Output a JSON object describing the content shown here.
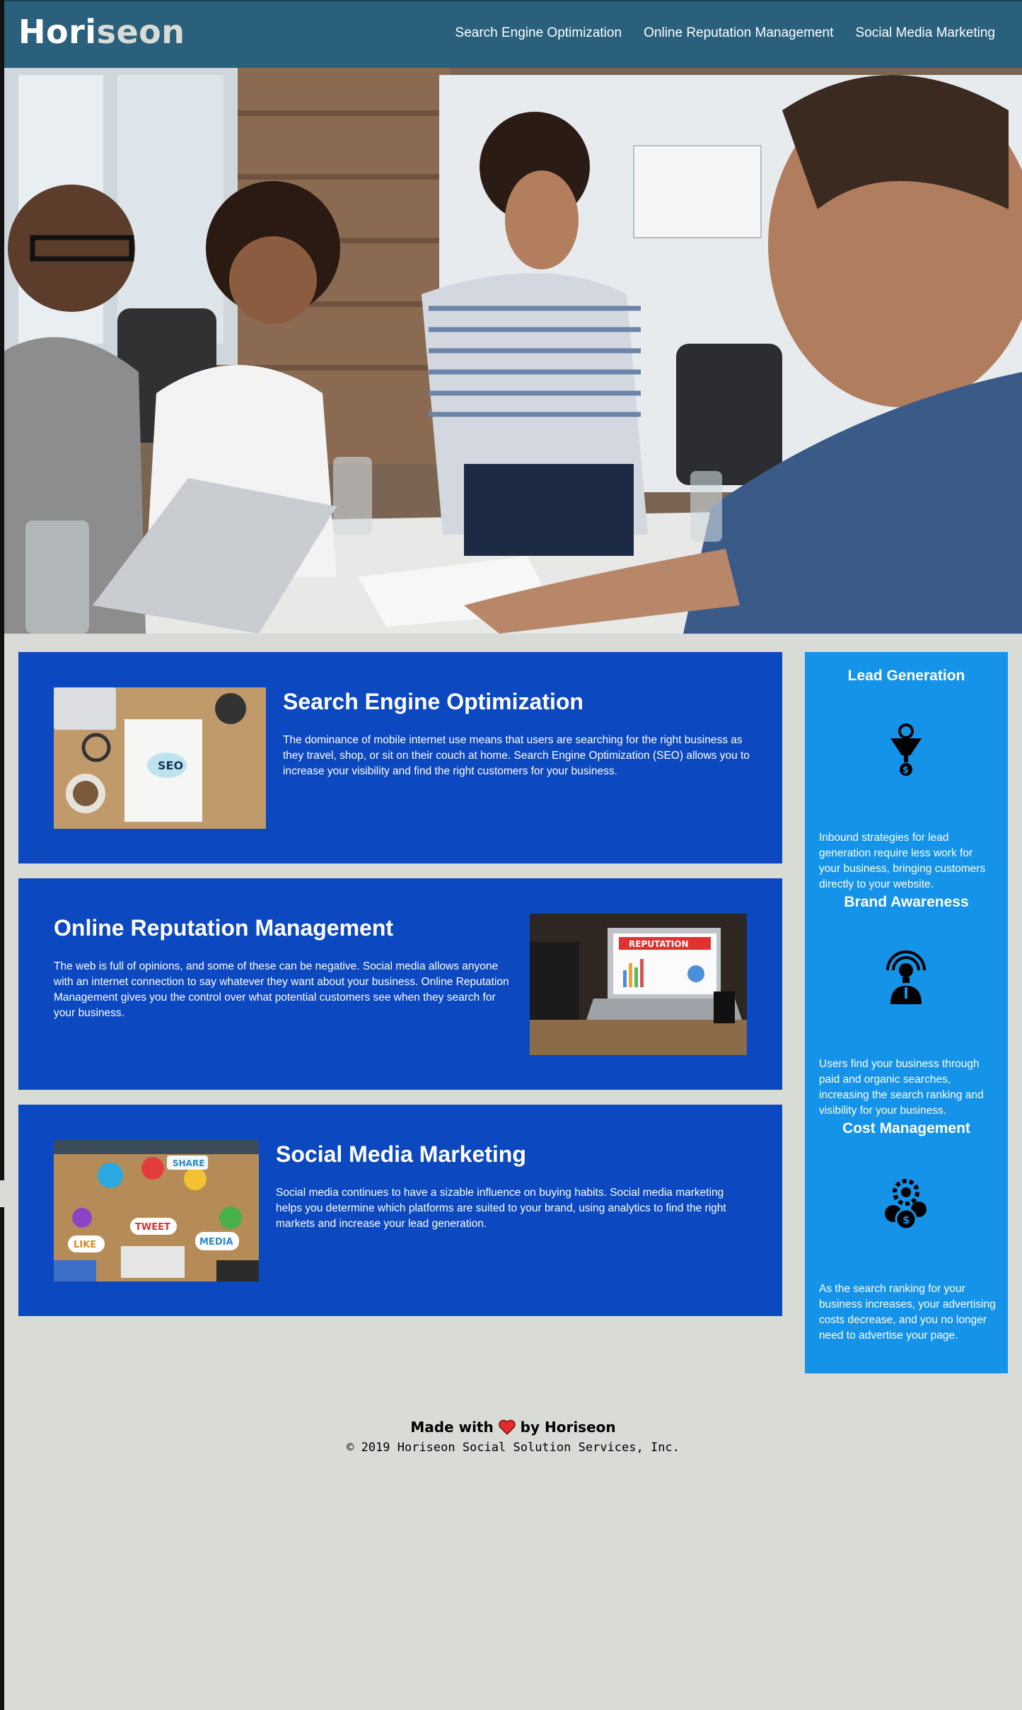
{
  "header": {
    "logo_part1": "Hori",
    "logo_part2": "seon",
    "nav": [
      {
        "label": "Search Engine Optimization"
      },
      {
        "label": "Online Reputation Management"
      },
      {
        "label": "Social Media Marketing"
      }
    ]
  },
  "hero": {
    "description": "team meeting around a table with laptop"
  },
  "cards": [
    {
      "title": "Search Engine Optimization",
      "text": "The dominance of mobile internet use means that users are searching for the right business as they travel, shop, or sit on their couch at home. Search Engine Optimization (SEO) allows you to increase your visibility and find the right customers for your business.",
      "image_label": "SEO"
    },
    {
      "title": "Online Reputation Management",
      "text": "The web is full of opinions, and some of these can be negative. Social media allows anyone with an internet connection to say whatever they want about your business. Online Reputation Management gives you the control over what potential customers see when they search for your business.",
      "image_label": "REPUTATION"
    },
    {
      "title": "Social Media Marketing",
      "text": "Social media continues to have a sizable influence on buying habits. Social media marketing helps you determine which platforms are suited to your brand, using analytics to find the right markets and increase your lead generation.",
      "image_labels": [
        "SHARE",
        "TWEET",
        "LIKE",
        "MEDIA"
      ]
    }
  ],
  "sidebar": [
    {
      "title": "Lead Generation",
      "icon": "funnel-dollar-icon",
      "text": "Inbound strategies for lead generation require less work for your business, bringing customers directly to your website."
    },
    {
      "title": "Brand Awareness",
      "icon": "lightbulb-person-icon",
      "text": "Users find your business through paid and organic searches, increasing the search ranking and visibility for your business."
    },
    {
      "title": "Cost Management",
      "icon": "gear-coins-icon",
      "text": "As the search ranking for your business increases, your advertising costs decrease, and you no longer need to advertise your page."
    }
  ],
  "footer": {
    "made_prefix": "Made with",
    "made_suffix": "by Horiseon",
    "copyright": "© 2019 Horiseon Social Solution Services, Inc."
  },
  "colors": {
    "header_bg": "#2a607c",
    "card_bg": "#0c48bf",
    "sidebar_bg": "#1493e9",
    "page_bg": "#d9dcd6"
  }
}
